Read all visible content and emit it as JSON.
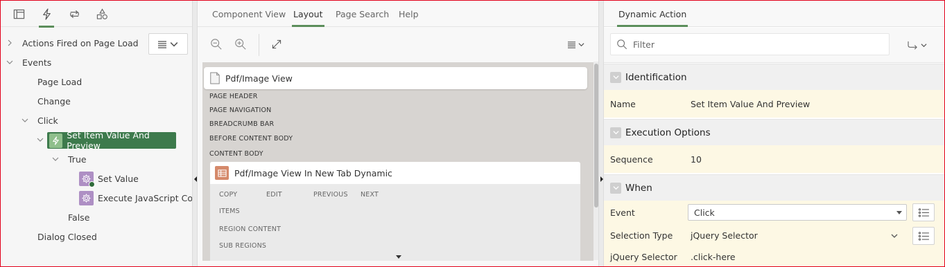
{
  "left_panel": {
    "tabs": [
      {
        "name": "rendering",
        "icon": "layout-icon"
      },
      {
        "name": "dynamic-actions",
        "icon": "bolt-icon"
      },
      {
        "name": "processing",
        "icon": "refresh-icon"
      },
      {
        "name": "shared-components",
        "icon": "shapes-icon"
      }
    ],
    "tree": {
      "actions_fired": "Actions Fired on Page Load",
      "events": "Events",
      "page_load": "Page Load",
      "change": "Change",
      "click": "Click",
      "selected_action": "Set Item Value And Preview",
      "true_branch": "True",
      "set_value": "Set Value",
      "execute_js": "Execute JavaScript Code",
      "false_branch": "False",
      "dialog_closed": "Dialog Closed"
    }
  },
  "middle_panel": {
    "tabs": [
      "Component View",
      "Layout",
      "Page Search",
      "Help"
    ],
    "active_tab": "Layout",
    "page_title": "Pdf/Image View",
    "positions": [
      "PAGE HEADER",
      "PAGE NAVIGATION",
      "BREADCRUMB BAR",
      "BEFORE CONTENT BODY",
      "CONTENT BODY"
    ],
    "region": {
      "title": "Pdf/Image View In New Tab Dynamic",
      "buttons": [
        "COPY",
        "EDIT",
        "PREVIOUS",
        "NEXT"
      ],
      "sections": [
        "ITEMS",
        "REGION CONTENT",
        "SUB REGIONS"
      ]
    }
  },
  "right_panel": {
    "tab": "Dynamic Action",
    "filter_placeholder": "Filter",
    "sections": {
      "identification": {
        "title": "Identification",
        "name_label": "Name",
        "name_value": "Set Item Value And Preview"
      },
      "execution": {
        "title": "Execution Options",
        "sequence_label": "Sequence",
        "sequence_value": "10"
      },
      "when": {
        "title": "When",
        "event_label": "Event",
        "event_value": "Click",
        "selection_type_label": "Selection Type",
        "selection_type_value": "jQuery Selector",
        "jquery_selector_label": "jQuery Selector",
        "jquery_selector_value": ".click-here"
      }
    }
  },
  "colors": {
    "accent_green": "#5c8e5b",
    "selected_node": "#3d7a4c",
    "property_row_bg": "#fdf8e4",
    "region_icon": "#d5896a",
    "gear_icon_bg": "#ae8fc4",
    "frame_border": "#e2001a"
  }
}
